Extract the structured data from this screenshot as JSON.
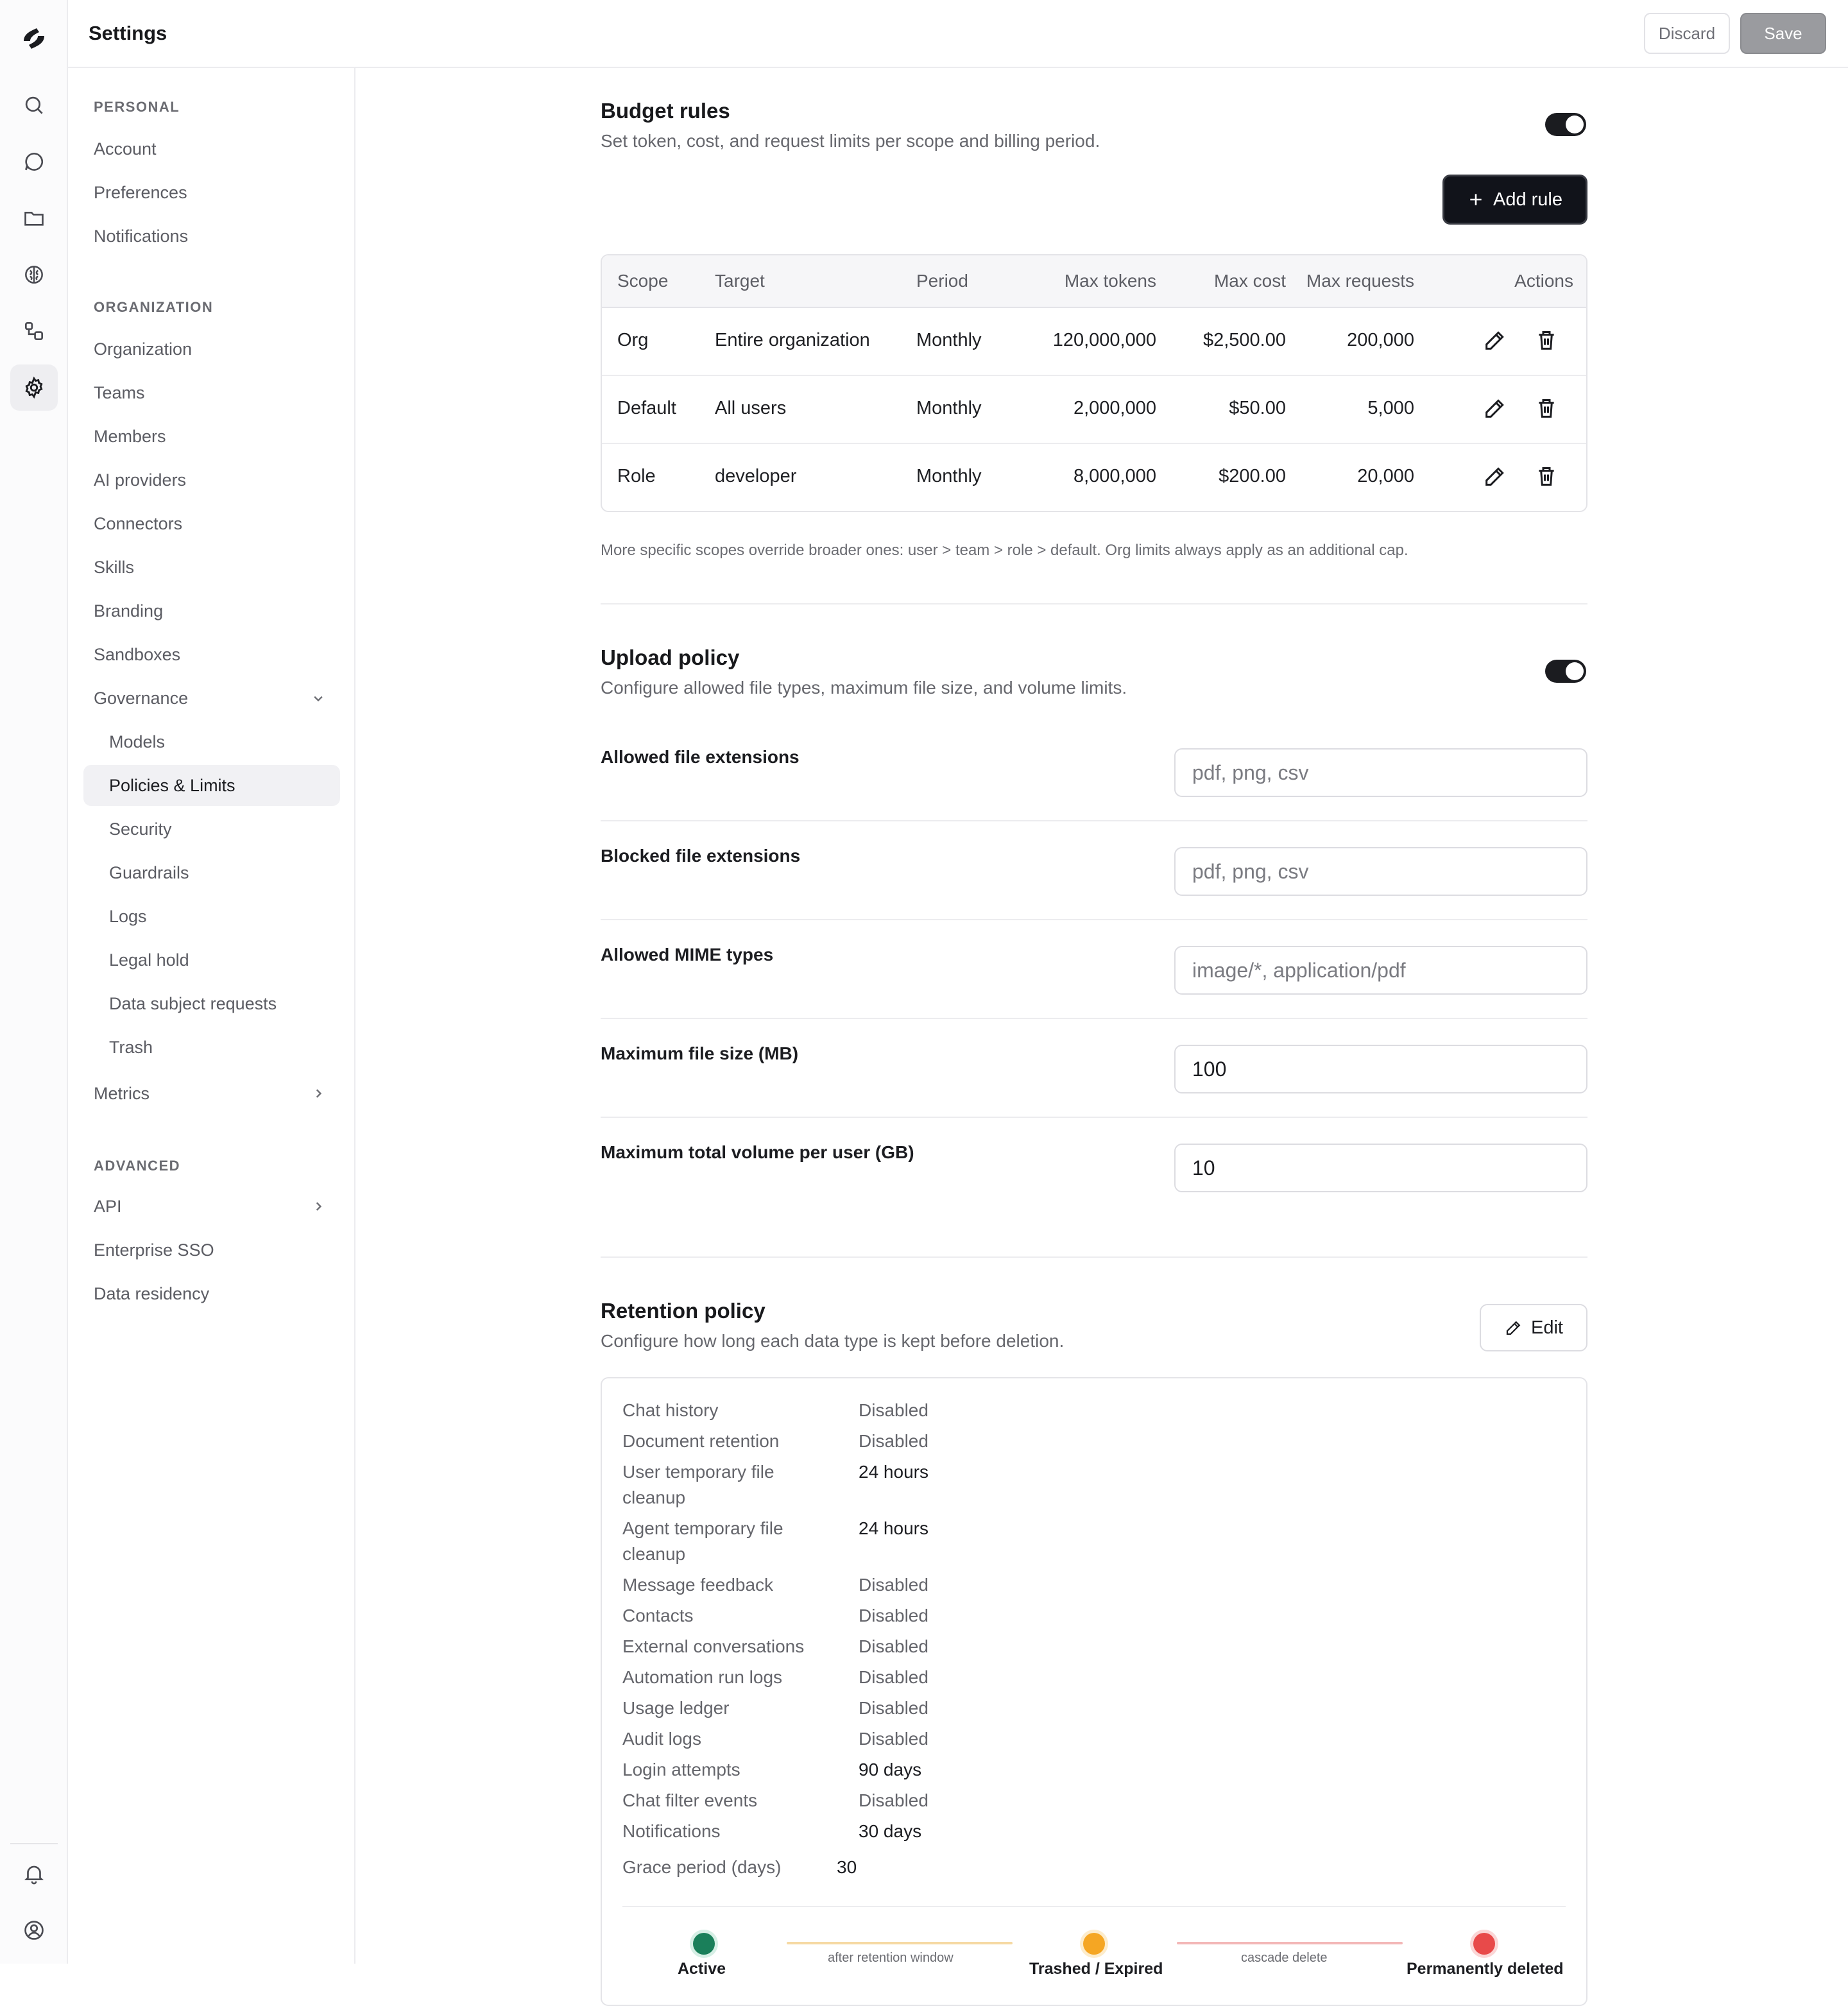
{
  "app": {
    "title": "Settings"
  },
  "header": {
    "discard_label": "Discard",
    "save_label": "Save"
  },
  "rail": {
    "icons": [
      "logo-icon",
      "search-icon",
      "chat-icon",
      "folder-icon",
      "brain-icon",
      "connectors-icon",
      "gear-icon",
      "bell-icon",
      "user-circle-icon"
    ],
    "active": "gear-icon"
  },
  "sidebar": {
    "personal_label": "PERSONAL",
    "personal": [
      "Account",
      "Preferences",
      "Notifications"
    ],
    "org_label": "ORGANIZATION",
    "org": [
      "Organization",
      "Teams",
      "Members",
      "AI providers",
      "Connectors",
      "Skills",
      "Branding",
      "Sandboxes",
      "Governance"
    ],
    "governance": [
      "Models",
      "Policies & Limits",
      "Security",
      "Guardrails",
      "Logs",
      "Legal hold",
      "Data subject requests",
      "Trash"
    ],
    "active_item": "Policies & Limits",
    "metrics": "Metrics",
    "advanced_label": "ADVANCED",
    "advanced": [
      "API",
      "Enterprise SSO",
      "Data residency"
    ]
  },
  "budget": {
    "title": "Budget rules",
    "description": "Set token, cost, and request limits per scope and billing period.",
    "enabled": true,
    "add_label": "Add rule",
    "columns": [
      "Scope",
      "Target",
      "Period",
      "Max tokens",
      "Max cost",
      "Max requests",
      "Actions"
    ],
    "rows": [
      [
        "Org",
        "Entire organization",
        "Monthly",
        "120,000,000",
        "$2,500.00",
        "200,000"
      ],
      [
        "Default",
        "All users",
        "Monthly",
        "2,000,000",
        "$50.00",
        "5,000"
      ],
      [
        "Role",
        "developer",
        "Monthly",
        "8,000,000",
        "$200.00",
        "20,000"
      ]
    ],
    "note": "More specific scopes override broader ones: user > team > role > default. Org limits always apply as an additional cap."
  },
  "upload": {
    "title": "Upload policy",
    "description": "Configure allowed file types, maximum file size, and volume limits.",
    "enabled": true,
    "fields": [
      {
        "label": "Allowed file extensions",
        "value": "",
        "placeholder": "pdf, png, csv"
      },
      {
        "label": "Blocked file extensions",
        "value": "",
        "placeholder": "pdf, png, csv"
      },
      {
        "label": "Allowed MIME types",
        "value": "",
        "placeholder": "image/*, application/pdf"
      },
      {
        "label": "Maximum file size (MB)",
        "value": "100",
        "placeholder": ""
      },
      {
        "label": "Maximum total volume per user (GB)",
        "value": "10",
        "placeholder": ""
      }
    ]
  },
  "retention": {
    "title": "Retention policy",
    "description": "Configure how long each data type is kept before deletion.",
    "edit_label": "Edit",
    "items": [
      {
        "k": "Chat history",
        "v": "Disabled"
      },
      {
        "k": "Document retention",
        "v": "Disabled"
      },
      {
        "k": "User temporary file cleanup",
        "v": "24 hours"
      },
      {
        "k": "Agent temporary file cleanup",
        "v": "24 hours"
      },
      {
        "k": "Message feedback",
        "v": "Disabled"
      },
      {
        "k": "Contacts",
        "v": "Disabled"
      },
      {
        "k": "External conversations",
        "v": "Disabled"
      },
      {
        "k": "Automation run logs",
        "v": "Disabled"
      },
      {
        "k": "Usage ledger",
        "v": "Disabled"
      },
      {
        "k": "Audit logs",
        "v": "Disabled"
      },
      {
        "k": "Login attempts",
        "v": "90 days"
      },
      {
        "k": "Chat filter events",
        "v": "Disabled"
      },
      {
        "k": "Notifications",
        "v": "30 days"
      }
    ],
    "grace": {
      "k": "Grace period (days)",
      "v": "30"
    },
    "stages": [
      {
        "label": "Active",
        "color": "#1a7f5a"
      },
      {
        "label": "Trashed / Expired",
        "color": "#f5a623"
      },
      {
        "label": "Permanently deleted",
        "color": "#e84a4a"
      }
    ],
    "transitions": [
      "after retention window",
      "cascade delete"
    ],
    "transition_colors": [
      "#f6d9a3",
      "#f3b7b7"
    ]
  }
}
